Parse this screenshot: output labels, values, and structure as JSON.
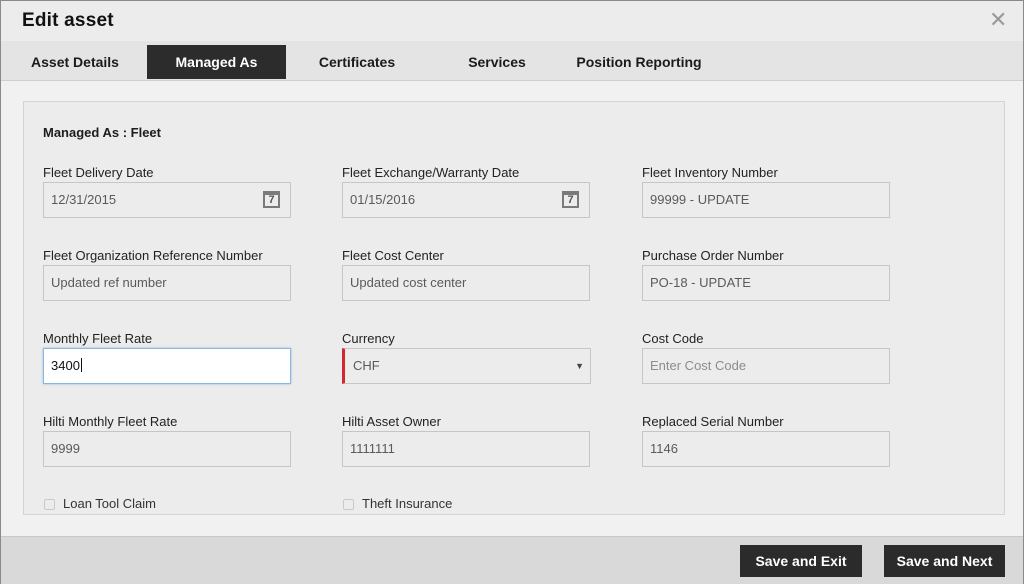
{
  "dialog": {
    "title": "Edit asset",
    "close_glyph": "✕"
  },
  "tabs": [
    {
      "label": "Asset Details",
      "active": false
    },
    {
      "label": "Managed As",
      "active": true
    },
    {
      "label": "Certificates",
      "active": false
    },
    {
      "label": "Services",
      "active": false
    },
    {
      "label": "Position Reporting",
      "active": false
    }
  ],
  "section": {
    "title": "Managed As : Fleet"
  },
  "fields": {
    "fleet_delivery_date": {
      "label": "Fleet Delivery Date",
      "value": "12/31/2015",
      "icon": "calendar-icon",
      "icon_text": "7"
    },
    "fleet_exchange_date": {
      "label": "Fleet Exchange/Warranty Date",
      "value": "01/15/2016",
      "icon": "calendar-icon",
      "icon_text": "7"
    },
    "fleet_inventory_number": {
      "label": "Fleet Inventory Number",
      "value": "99999 - UPDATE"
    },
    "fleet_org_ref_number": {
      "label": "Fleet Organization Reference Number",
      "value": "Updated ref number"
    },
    "fleet_cost_center": {
      "label": "Fleet Cost Center",
      "value": "Updated cost center"
    },
    "purchase_order_number": {
      "label": "Purchase Order Number",
      "value": "PO-18 - UPDATE"
    },
    "monthly_fleet_rate": {
      "label": "Monthly Fleet Rate",
      "value": "3400"
    },
    "currency": {
      "label": "Currency",
      "value": "CHF",
      "caret": "▼"
    },
    "cost_code": {
      "label": "Cost Code",
      "value": "",
      "placeholder": "Enter Cost Code"
    },
    "hilti_monthly_fleet_rate": {
      "label": "Hilti Monthly Fleet Rate",
      "value": "9999"
    },
    "hilti_asset_owner": {
      "label": "Hilti Asset Owner",
      "value": "1111111"
    },
    "replaced_serial_number": {
      "label": "Replaced Serial Number",
      "value": "1146"
    }
  },
  "checkboxes": {
    "loan_tool_claim": {
      "label": "Loan Tool Claim",
      "checked": false
    },
    "theft_insurance": {
      "label": "Theft Insurance",
      "checked": false
    }
  },
  "footer": {
    "save_exit_label": "Save and Exit",
    "save_next_label": "Save and Next"
  },
  "colors": {
    "accent_red": "#d6262e",
    "active_tab": "#2c2c2c",
    "focus_border": "#8ab7e0"
  }
}
